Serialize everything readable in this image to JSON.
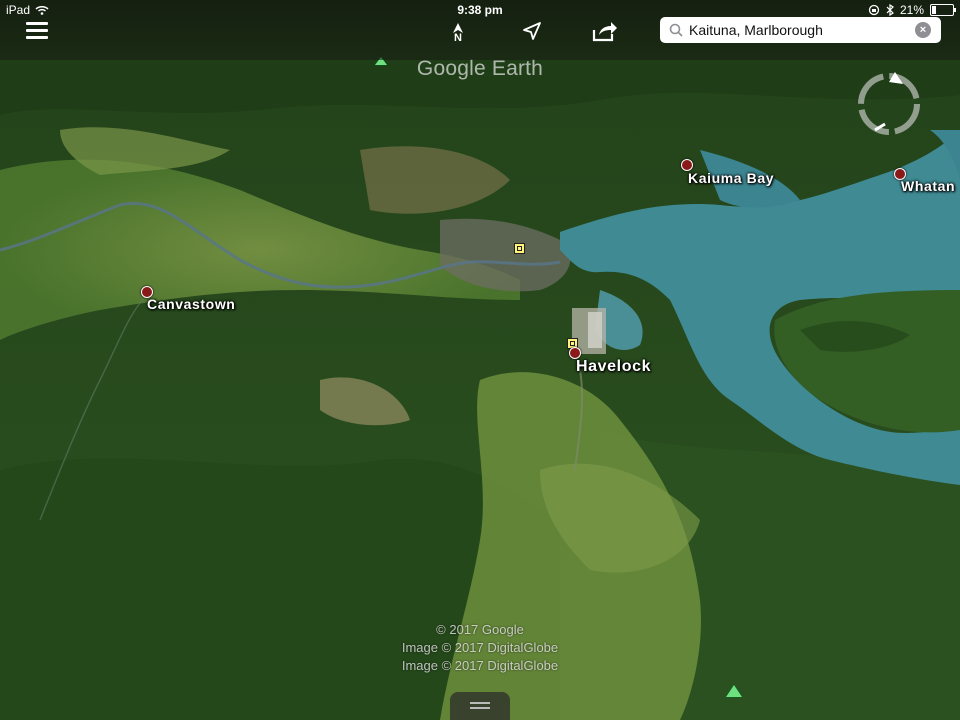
{
  "status_bar": {
    "device": "iPad",
    "time": "9:38 pm",
    "battery_text": "21%",
    "battery_level": 0.21
  },
  "toolbar": {
    "menu_icon": "hamburger-menu-icon",
    "north_icon": "north-arrow-icon",
    "north_label": "N",
    "location_icon": "location-arrow-icon",
    "share_icon": "share-icon"
  },
  "search": {
    "value": "Kaituna, Marlborough",
    "search_icon": "search-icon",
    "clear_icon": "clear-icon",
    "clear_glyph": "×"
  },
  "map": {
    "watermark": "Google Earth",
    "places": [
      {
        "name": "Canvastown"
      },
      {
        "name": "Kaiuma Bay"
      },
      {
        "name": "Whatan"
      },
      {
        "name": "Havelock"
      }
    ],
    "credits": [
      "© 2017 Google",
      "Image © 2017 DigitalGlobe",
      "Image © 2017 DigitalGlobe"
    ],
    "colors": {
      "water": "#3f8a93",
      "forest": "#2d5a22",
      "pasture": "#6b8a3a",
      "pin": "#8a1a1a",
      "poi": "#fff37a",
      "peak": "#6ee07e"
    }
  }
}
